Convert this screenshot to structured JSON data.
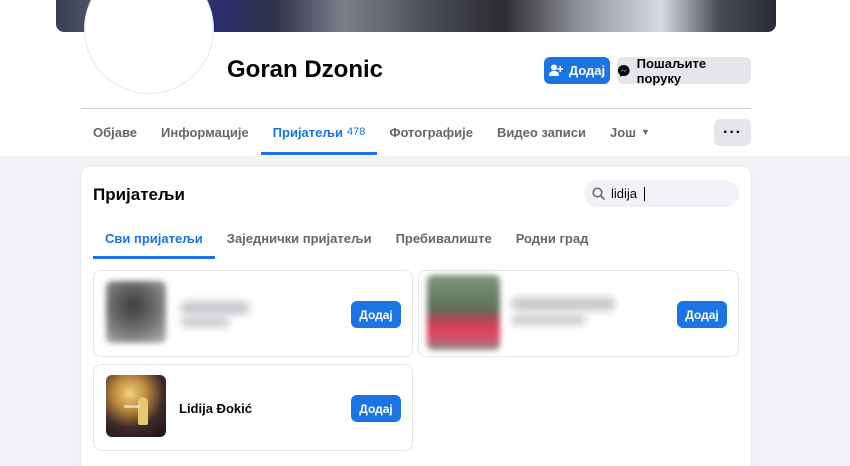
{
  "profile": {
    "name": "Goran Dzonic",
    "add_friend_label": "Додај",
    "message_label": "Пошаљите поруку"
  },
  "nav": {
    "tabs": [
      {
        "label": "Објаве"
      },
      {
        "label": "Информације"
      },
      {
        "label": "Пријатељи",
        "count": "478",
        "active": true
      },
      {
        "label": "Фотографије"
      },
      {
        "label": "Видео записи"
      },
      {
        "label": "Још"
      }
    ],
    "more_label": "···"
  },
  "friends_section": {
    "title": "Пријатељи",
    "search_value": "lidija",
    "subtabs": [
      {
        "label": "Сви пријатељи",
        "active": true
      },
      {
        "label": "Заједнички пријатељи"
      },
      {
        "label": "Пребивалиште"
      },
      {
        "label": "Родни град"
      }
    ],
    "cards": [
      {
        "name": "",
        "add_label": "Додај"
      },
      {
        "name": "",
        "add_label": "Додај"
      },
      {
        "name": "Lidija Đokić",
        "add_label": "Додај"
      }
    ]
  },
  "colors": {
    "accent": "#1b74e4",
    "background": "#f0f2f5"
  }
}
